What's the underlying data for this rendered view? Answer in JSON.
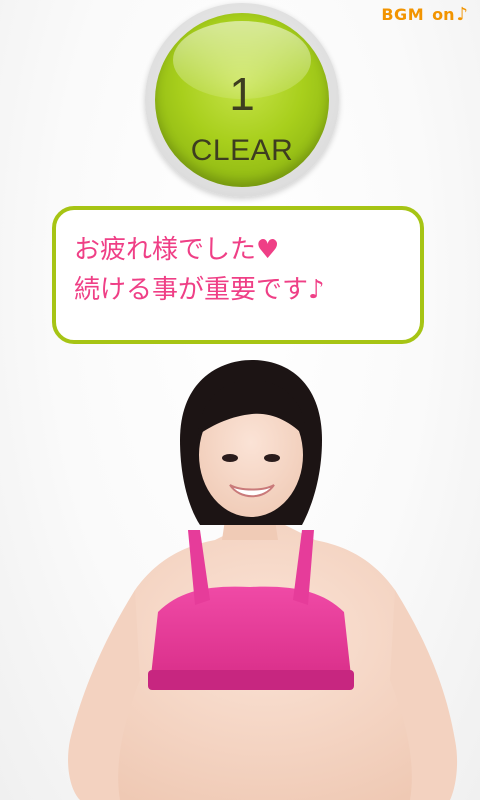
{
  "header": {
    "bgm_label": "BGM",
    "bgm_state": "on",
    "bgm_icon": "music-note-icon",
    "bgm_icon_glyph": "♪",
    "accent_color": "#f29400"
  },
  "badge": {
    "number": "1",
    "label": "CLEAR",
    "color": "#a8cf1c"
  },
  "message": {
    "line1": "お疲れ様でした♥",
    "line2": "続ける事が重要です♪",
    "text_color": "#ef3f86",
    "border_color": "#a6c414"
  },
  "figure": {
    "top_color": "#e63c9a"
  }
}
